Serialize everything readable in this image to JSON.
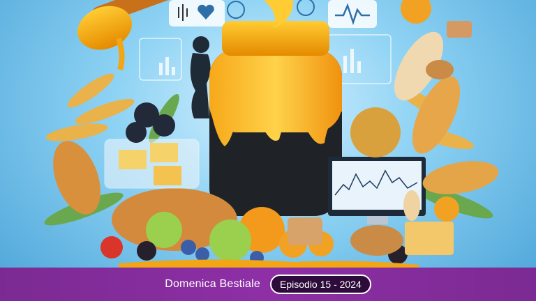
{
  "footer": {
    "show_title": "Domenica Bestiale",
    "episode_label": "Episodio 15 - 2024"
  },
  "colors": {
    "footer_bg": "#8e2fa6",
    "pill_bg": "#2d0b3a",
    "honey": "#f2a515",
    "sky": "#8fd3f4"
  },
  "icons": [
    "sound-wave-icon",
    "heart-icon",
    "leaf-icon",
    "globe-icon",
    "heart-monitor-icon",
    "bar-chart-icon",
    "line-chart-monitor-icon"
  ]
}
